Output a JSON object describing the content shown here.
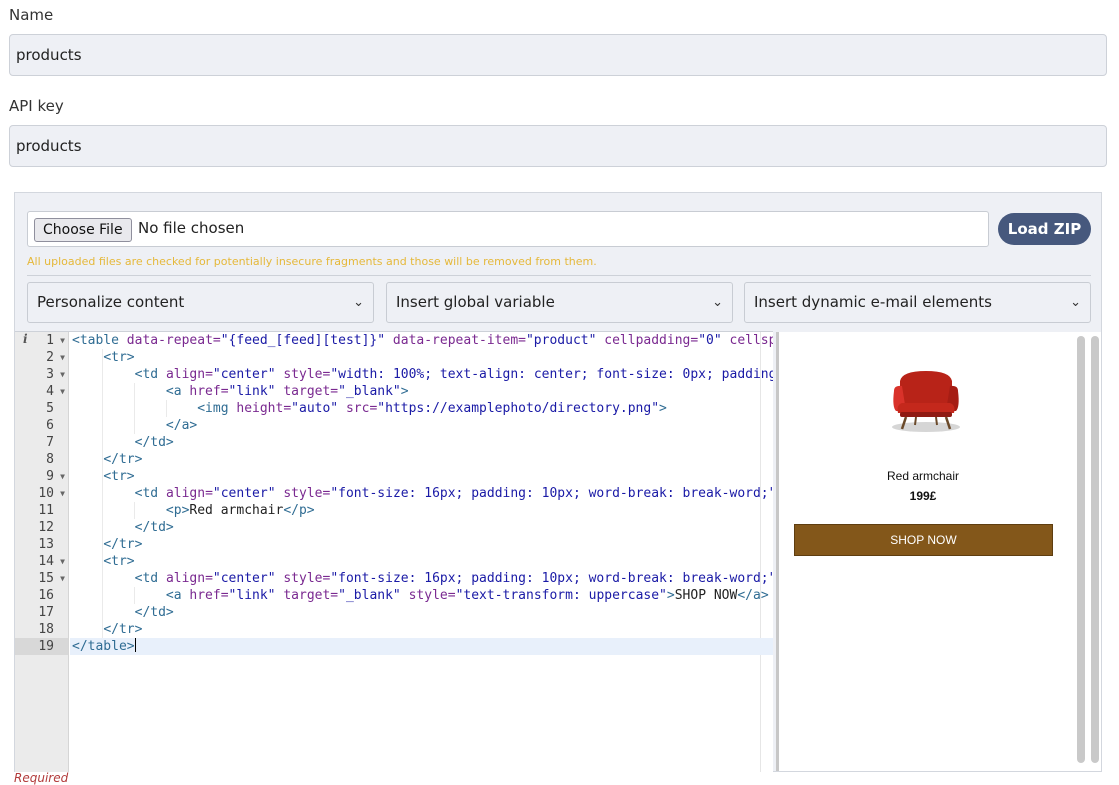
{
  "name_field": {
    "label": "Name",
    "value": "products"
  },
  "api_field": {
    "label": "API key",
    "value": "products"
  },
  "upload": {
    "choose_label": "Choose File",
    "status": "No file chosen",
    "load_zip": "Load ZIP",
    "warning": "All uploaded files are checked for potentially insecure fragments and those will be removed from them."
  },
  "selects": [
    {
      "value": "Personalize content"
    },
    {
      "value": "Insert global variable"
    },
    {
      "value": "Insert dynamic e-mail elements"
    }
  ],
  "editor": {
    "info_icon": "info-icon",
    "active_line": 19,
    "line_numbers": [
      "1",
      "2",
      "3",
      "4",
      "5",
      "6",
      "7",
      "8",
      "9",
      "10",
      "11",
      "12",
      "13",
      "14",
      "15",
      "16",
      "17",
      "18",
      "19"
    ],
    "fold_lines": [
      1,
      2,
      3,
      4,
      9,
      10,
      14,
      15
    ]
  },
  "preview": {
    "product_name": "Red armchair",
    "price": "199£",
    "button": "SHOP NOW",
    "image_icon": "armchair-image",
    "colors": {
      "button_bg": "#83571a",
      "chair": "#c4281c"
    }
  },
  "required_note": "Required"
}
